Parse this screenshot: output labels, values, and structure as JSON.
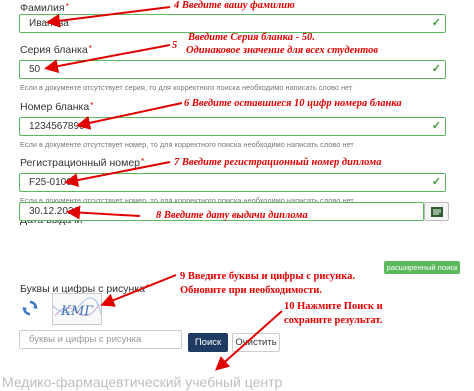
{
  "form": {
    "surname": {
      "label": "Фамилия",
      "value": "Иванова"
    },
    "series": {
      "label": "Серия бланка",
      "value": "50",
      "hint": "Если в документе отсутствует серия, то для корректного поиска необходимо написать слово нет"
    },
    "number": {
      "label": "Номер бланка",
      "value": "1234567890",
      "hint": "Если в документе отсутствует номер, то для корректного поиска необходимо написать слово нет"
    },
    "regnum": {
      "label": "Регистрационный номер",
      "value": "F25-01000",
      "hint": "Если в документе отсутствует номер, то для корректного поиска необходимо написать слово нет"
    },
    "date": {
      "label": "Дата выдачи",
      "value": "30.12.2021"
    },
    "extended_search_label": "расширенный поиск",
    "captcha": {
      "label": "Буквы и цифры с рисунка",
      "image_text": "КМГ",
      "placeholder": "буквы и цифры с рисунка"
    },
    "search_button": "Поиск",
    "clear_button": "Очистить",
    "required_mark": "*",
    "valid_mark": "✓"
  },
  "annotations": {
    "a4": "4 Введите вашу фамилию",
    "a5_num": "5",
    "a5_line1": "Введите Серия бланка - 50.",
    "a5_line2": "Одинаковое значение для всех студентов",
    "a6": "6  Введите оставшиеся 10 цифр номера бланка",
    "a7": "7  Введите регистрационный номер диплома",
    "a8": "8 Введите дату выдачи диплома",
    "a9_line1": "9 Введите буквы и цифры с рисунка.",
    "a9_line2": "Обновите при необходимости.",
    "a10_line1": "10 Нажмите Поиск и",
    "a10_line2": "сохраните результат."
  },
  "watermark": "Медико-фармацевтический учебный центр",
  "colors": {
    "annotation": "#e00000",
    "valid_border": "#5cb85c",
    "search_button": "#1f3a63",
    "extended_button": "#5cb85c"
  }
}
